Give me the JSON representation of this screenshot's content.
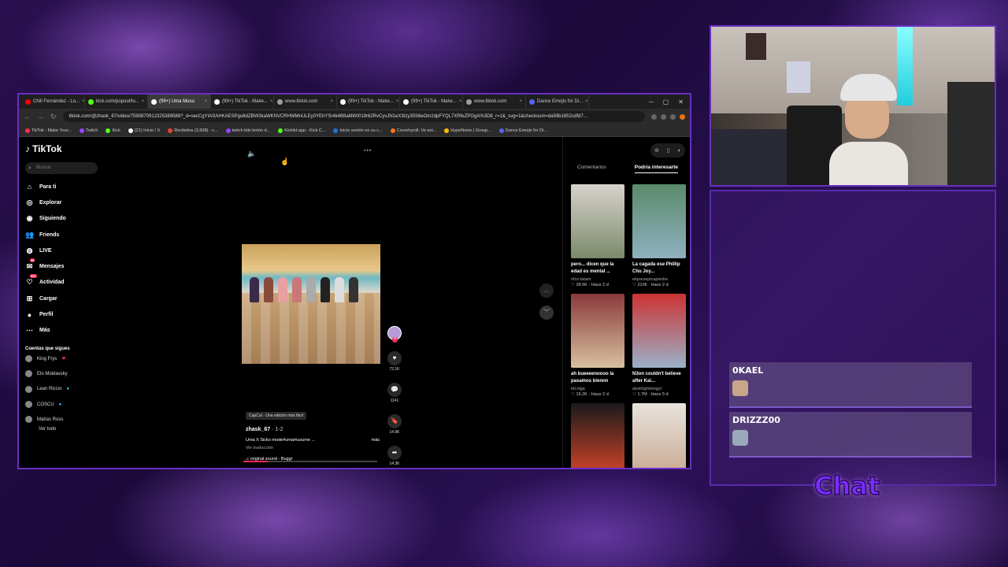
{
  "browser": {
    "tabs": [
      {
        "title": "Chili Fernández - Lo...",
        "color": "#ff0000"
      },
      {
        "title": "kick.com/popout/lu...",
        "color": "#53fc18"
      },
      {
        "title": "(99+) Uma Musu",
        "color": "#ffffff",
        "active": true
      },
      {
        "title": "(99+) TikTok - Make...",
        "color": "#ffffff"
      },
      {
        "title": "www.tiktok.com",
        "color": "#9aa0a6"
      },
      {
        "title": "(99+) TikTok - Make...",
        "color": "#ffffff"
      },
      {
        "title": "(99+) TikTok - Make...",
        "color": "#ffffff"
      },
      {
        "title": "www.tiktok.com",
        "color": "#9aa0a6"
      },
      {
        "title": "Dance Emojis for Di...",
        "color": "#5865f2"
      }
    ],
    "url": "tiktok.com/@zhask_67/video/7590870912325389588?_d=secCgYIASAHKAESPgo8dZBW3kaWKNVCRHWMnULEy0YEhYSr4k4B8aMWI019r62RvCyvJN1eX3Izy35S6eOm2dpFYQL7XRfeZPGgA%3D8_r=1&_svg=1&checksum=da59b1652cdfd7...",
    "bookmarks": [
      "TikTok - Make Your...",
      "Twitch",
      "Kick",
      "(21) Inicio / X",
      "Recibidos (3,608) - c...",
      "twitch bits botón d...",
      "Kicklet.app - Kick C...",
      "Inicie sesión en su c...",
      "Crunchyroll: Ve ani...",
      "HypeNoise | Group...",
      "Dance Emojis for Di..."
    ]
  },
  "tiktok": {
    "logo": "TikTok",
    "search_placeholder": "Buscar",
    "menu": [
      {
        "label": "Para ti",
        "icon": "home-icon"
      },
      {
        "label": "Explorar",
        "icon": "compass-icon"
      },
      {
        "label": "Siguiendo",
        "icon": "following-icon"
      },
      {
        "label": "Friends",
        "icon": "friends-icon"
      },
      {
        "label": "LIVE",
        "icon": "live-icon"
      },
      {
        "label": "Mensajes",
        "icon": "messages-icon",
        "badge": "49"
      },
      {
        "label": "Actividad",
        "icon": "activity-icon",
        "badge": "99+"
      },
      {
        "label": "Cargar",
        "icon": "upload-icon"
      },
      {
        "label": "Perfil",
        "icon": "profile-icon"
      },
      {
        "label": "Más",
        "icon": "more-icon"
      }
    ],
    "following_title": "Cuentas que sigues",
    "following": [
      {
        "name": "King Frys",
        "mark": "❤"
      },
      {
        "name": "Elo Moldavsky",
        "mark": ""
      },
      {
        "name": "Lean Riccio",
        "mark": "●"
      },
      {
        "name": "COSCU",
        "mark": "●"
      },
      {
        "name": "Matías Ross",
        "mark": ""
      }
    ],
    "see_all": "Ver todo",
    "video": {
      "capcut": "CapCut · Una edición más fácil",
      "author": "zhask_67",
      "date": " · 1-2",
      "description": "Uma X Sicko mode#umamusume ...",
      "more": "más",
      "translate": "Ver traducción",
      "sound": "original sound - Buggr",
      "progress": 0.18,
      "likes": "72.1K",
      "comments": "1141",
      "saves": "14.9K",
      "shares": "14.3K"
    },
    "right_tabs": [
      "Comentarios",
      "Podría interesarte"
    ],
    "cards": [
      {
        "title": "pero... dicen que la edad es mental ...",
        "user": "nfco.latam",
        "likes": "28.6K",
        "age": "Hace 2 d",
        "c1": "#d7d2cc",
        "c2": "#7b8a6a"
      },
      {
        "title": "La cagada ese Phillip Chu Joy...",
        "user": "elquesepicapiedra",
        "likes": "2106",
        "age": "Hace 2 d",
        "c1": "#5a8a6a",
        "c2": "#8fb0c0"
      },
      {
        "title": "ah bueeeenoooo la pasamos biennn",
        "user": "tdi.olga",
        "likes": "19.2K",
        "age": "Hace 2 d",
        "c1": "#8a3a3a",
        "c2": "#d8c0a0"
      },
      {
        "title": "N3on couldn't believe after Kai...",
        "user": "atomlightningyt",
        "likes": "1.7M",
        "age": "Hace 5 d",
        "c1": "#c33",
        "c2": "#9ab0c8"
      },
      {
        "title": "",
        "user": "",
        "likes": "",
        "age": "",
        "c1": "#1a1a1a",
        "c2": "#d9452a"
      },
      {
        "title": "",
        "user": "",
        "likes": "",
        "age": "",
        "c1": "#e8e3dc",
        "c2": "#c8a890"
      }
    ]
  },
  "chat": {
    "label": "Chat",
    "messages": [
      {
        "user": "0KAEL"
      },
      {
        "user": "DRIZZZ00"
      }
    ]
  }
}
